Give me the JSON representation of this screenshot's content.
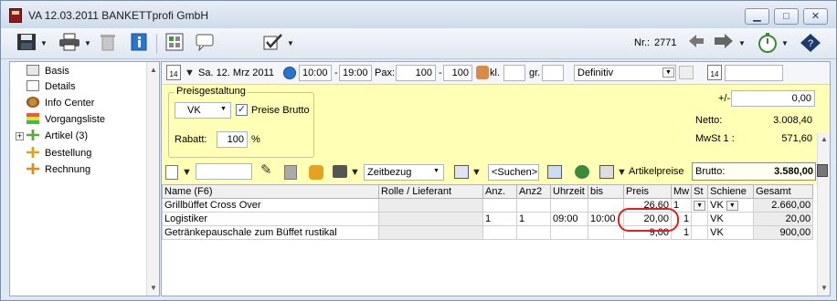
{
  "window": {
    "title": "VA 12.03.2011 BANKETTprofi GmbH",
    "minimize": "▁",
    "maximize": "□",
    "close": "✕"
  },
  "toolbar": {
    "nr_label": "Nr.:",
    "nr_value": "2771"
  },
  "sidebar": {
    "items": [
      {
        "label": "Basis",
        "icon": "basis-icon"
      },
      {
        "label": "Details",
        "icon": "details-icon"
      },
      {
        "label": "Info Center",
        "icon": "info-center-icon"
      },
      {
        "label": "Vorgangsliste",
        "icon": "vorgangsliste-icon"
      },
      {
        "label": "Artikel (3)",
        "icon": "artikel-icon"
      },
      {
        "label": "Bestellung",
        "icon": "bestellung-icon"
      },
      {
        "label": "Rechnung",
        "icon": "rechnung-icon"
      }
    ],
    "expander": "+"
  },
  "datebar": {
    "date": "Sa. 12. Mrz 2011",
    "time_from": "10:00",
    "time_sep": "-",
    "time_to": "19:00",
    "pax_label": "Pax:",
    "pax_from": "100",
    "pax_sep": "-",
    "pax_to": "100",
    "kl_label": "kl.",
    "gr_label": "gr.",
    "status": "Definitiv"
  },
  "preisgestaltung": {
    "title": "Preisgestaltung",
    "vk": "VK",
    "brutto_label": "Preise Brutto",
    "brutto_checked": "✓",
    "rabatt_label": "Rabatt:",
    "rabatt_value": "100",
    "rabatt_unit": "%"
  },
  "summary": {
    "plusminus_label": "+/-",
    "plusminus_value": "0,00",
    "netto_label": "Netto:",
    "netto_value": "3.008,40",
    "mwst_label": "MwSt 1 :",
    "mwst_value": "571,60",
    "brutto_label": "Brutto:",
    "brutto_value": "3.580,00"
  },
  "tools2": {
    "zeitbezug": "Zeitbezug",
    "suchen": "<Suchen>",
    "artikelpreise": "Artikelpreise"
  },
  "grid": {
    "columns": [
      "Name (F6)",
      "Rolle / Lieferant",
      "Anz.",
      "Anz2",
      "Uhrzeit",
      "bis",
      "Preis",
      "Mw",
      "St",
      "Schiene",
      "Gesamt"
    ],
    "rows": [
      {
        "name": "Grillbüffet Cross Over",
        "rolle": "",
        "anz": "",
        "anz2": "",
        "uhrzeit": "",
        "bis": "",
        "preis": "26,60",
        "mw": "1",
        "st": "",
        "schiene": "VK",
        "gesamt": "2.660,00"
      },
      {
        "name": "Logistiker",
        "rolle": "",
        "anz": "1",
        "anz2": "1",
        "uhrzeit": "09:00",
        "bis": "10:00",
        "preis": "20,00",
        "mw": "1",
        "st": "",
        "schiene": "VK",
        "gesamt": "20,00"
      },
      {
        "name": "Getränkepauschale zum Büffet rustikal",
        "rolle": "",
        "anz": "",
        "anz2": "",
        "uhrzeit": "",
        "bis": "",
        "preis": "9,00",
        "mw": "1",
        "st": "",
        "schiene": "VK",
        "gesamt": "900,00"
      }
    ]
  },
  "colors": {
    "yellow_panel": "#ffffb6",
    "highlight": "#e02020",
    "accent": "#1a6fd0"
  }
}
